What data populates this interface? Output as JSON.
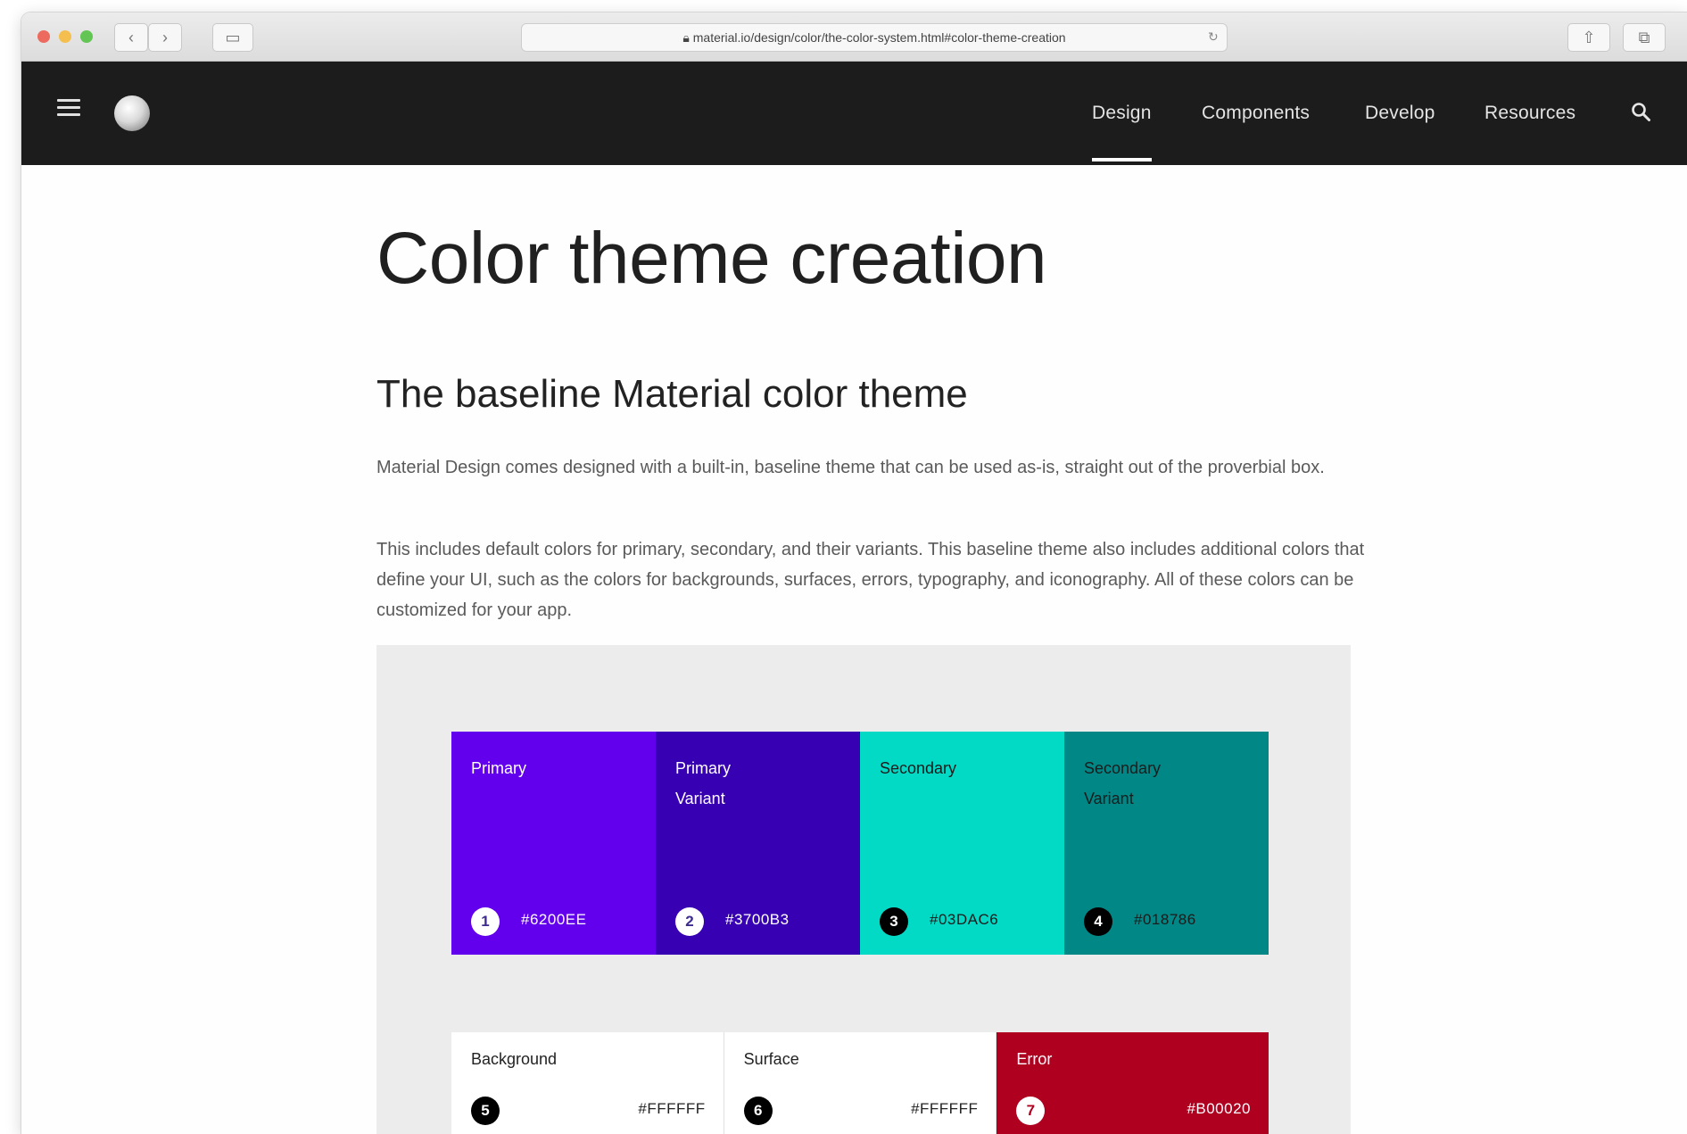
{
  "browser": {
    "url": "material.io/design/color/the-color-system.html#color-theme-creation"
  },
  "nav": {
    "items": [
      {
        "label": "Design",
        "active": true
      },
      {
        "label": "Components",
        "active": false
      },
      {
        "label": "Develop",
        "active": false
      },
      {
        "label": "Resources",
        "active": false
      }
    ]
  },
  "content": {
    "title": "Color theme creation",
    "section_title": "The baseline Material color theme",
    "paragraph_1": "Material Design comes designed with a built-in, baseline theme that can be used as-is, straight out of the proverbial box.",
    "paragraph_2": "This includes default colors for primary, secondary, and their variants. This baseline theme also includes additional colors that define your UI, such as the colors for backgrounds, surfaces, errors, typography, and iconography. All of these colors can be customized for your app."
  },
  "theme_colors": [
    {
      "number": "1",
      "name": "Primary",
      "hex": "#6200EE",
      "color": "#6200EE"
    },
    {
      "number": "2",
      "name": "Primary Variant",
      "hex": "#3700B3",
      "color": "#3700B3"
    },
    {
      "number": "3",
      "name": "Secondary",
      "hex": "#03DAC6",
      "color": "#03DAC6"
    },
    {
      "number": "4",
      "name": "Secondary Variant",
      "hex": "#018786",
      "color": "#018786"
    }
  ],
  "surface_colors": [
    {
      "number": "5",
      "name": "Background",
      "hex": "#FFFFFF",
      "color": "#FFFFFF"
    },
    {
      "number": "6",
      "name": "Surface",
      "hex": "#FFFFFF",
      "color": "#FFFFFF"
    },
    {
      "number": "7",
      "name": "Error",
      "hex": "#B00020",
      "color": "#B00020"
    }
  ]
}
